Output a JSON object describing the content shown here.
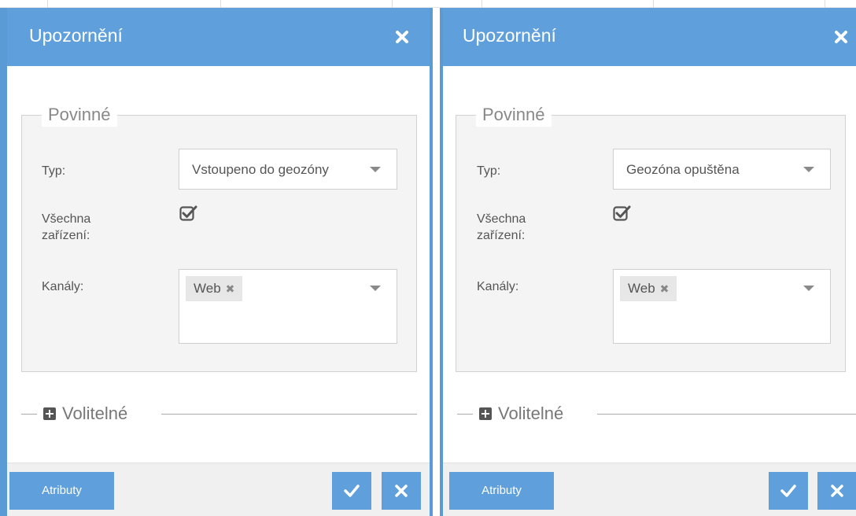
{
  "dialogs": [
    {
      "title": "Upozornění",
      "required_legend": "Povinné",
      "type_label": "Typ:",
      "type_value": "Vstoupeno do geozóny",
      "all_devices_label": "Všechna zařízení:",
      "all_devices_checked": true,
      "channels_label": "Kanály:",
      "channels": [
        "Web"
      ],
      "optional_legend": "Volitelné",
      "attributes_button": "Atributy"
    },
    {
      "title": "Upozornění",
      "required_legend": "Povinné",
      "type_label": "Typ:",
      "type_value": "Geozóna opuštěna",
      "all_devices_label": "Všechna zařízení:",
      "all_devices_checked": true,
      "channels_label": "Kanály:",
      "channels": [
        "Web"
      ],
      "optional_legend": "Volitelné",
      "attributes_button": "Atributy"
    }
  ],
  "icons": {
    "close": "close-icon",
    "check": "check-icon",
    "checkbox": "checkbox-checked-icon",
    "plus": "plus-square-icon",
    "dropdown": "caret-down-icon",
    "tag_remove": "remove-tag-icon"
  },
  "colors": {
    "accent": "#5fa0dc",
    "border": "#5b9bd5",
    "fieldset_bg": "#f4f4f4",
    "text": "#555555"
  }
}
